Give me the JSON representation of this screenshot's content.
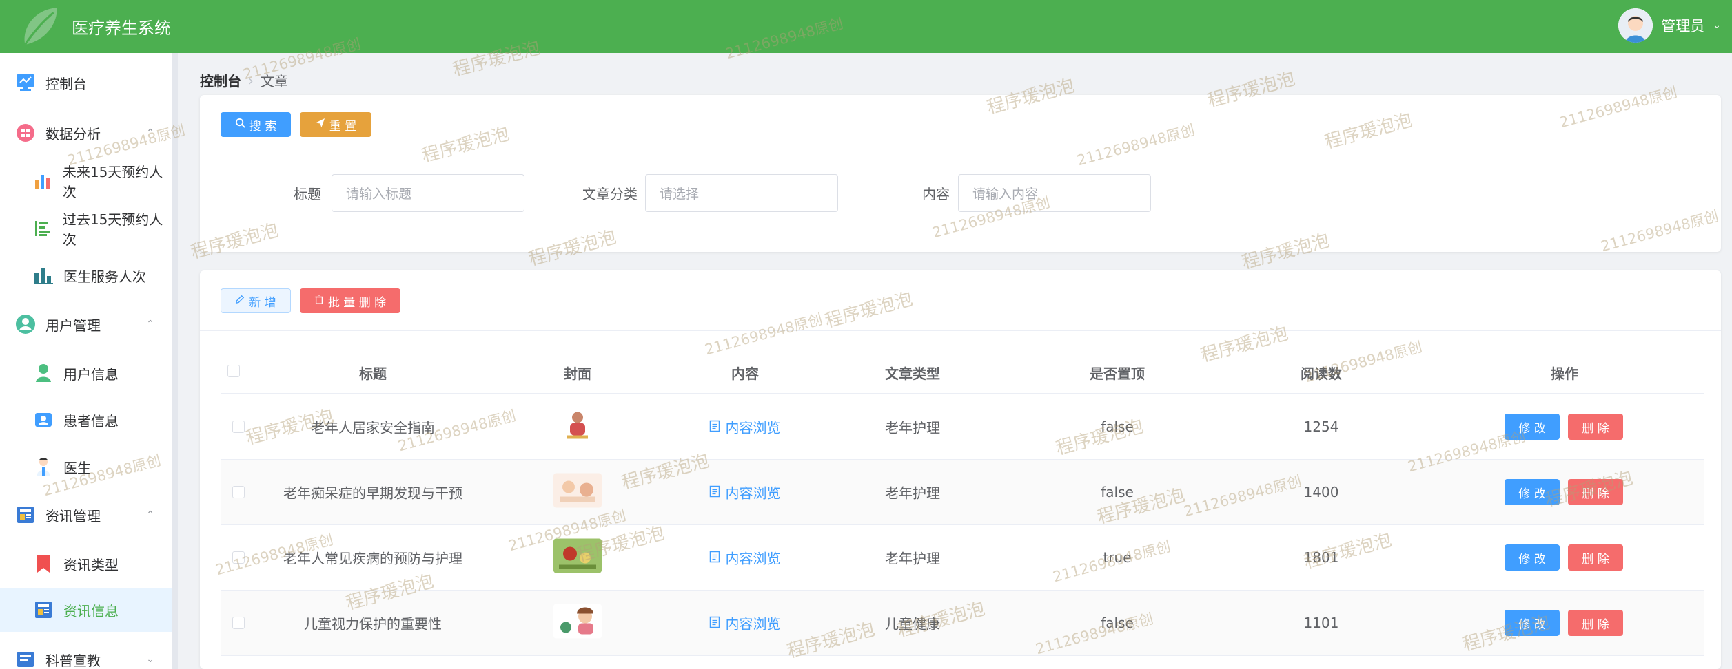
{
  "app": {
    "title": "医疗养生系统"
  },
  "user": {
    "name": "管理员"
  },
  "sidebar": {
    "items": [
      {
        "label": "控制台"
      },
      {
        "label": "数据分析"
      },
      {
        "label": "未来15天预约人次"
      },
      {
        "label": "过去15天预约人次"
      },
      {
        "label": "医生服务人次"
      },
      {
        "label": "用户管理"
      },
      {
        "label": "用户信息"
      },
      {
        "label": "患者信息"
      },
      {
        "label": "医生"
      },
      {
        "label": "资讯管理"
      },
      {
        "label": "资讯类型"
      },
      {
        "label": "资讯信息"
      },
      {
        "label": "科普宣教"
      }
    ]
  },
  "breadcrumb": {
    "root": "控制台",
    "current": "文章"
  },
  "search": {
    "search_label": "搜 索",
    "reset_label": "重 置",
    "fields": [
      {
        "label": "标题",
        "placeholder": "请输入标题"
      },
      {
        "label": "文章分类",
        "placeholder": "请选择"
      },
      {
        "label": "内容",
        "placeholder": "请输入内容"
      }
    ]
  },
  "actions": {
    "add_label": "新 增",
    "batch_delete_label": "批 量 删 除"
  },
  "table": {
    "columns": [
      "标题",
      "封面",
      "内容",
      "文章类型",
      "是否置顶",
      "阅读数",
      "操作"
    ],
    "view_label": "内容浏览",
    "edit_label": "修 改",
    "delete_label": "删 除",
    "rows": [
      {
        "title": "老年人居家安全指南",
        "type": "老年护理",
        "pinned": "false",
        "reads": "1254"
      },
      {
        "title": "老年痴呆症的早期发现与干预",
        "type": "老年护理",
        "pinned": "false",
        "reads": "1400"
      },
      {
        "title": "老年人常见疾病的预防与护理",
        "type": "老年护理",
        "pinned": "true",
        "reads": "1801"
      },
      {
        "title": "儿童视力保护的重要性",
        "type": "儿童健康",
        "pinned": "false",
        "reads": "1101"
      }
    ]
  },
  "watermark": {
    "text_a": "程序瑗泡泡",
    "text_b": "2112698948原创"
  },
  "colors": {
    "header": "#4caf50",
    "primary": "#409eff",
    "warning": "#e6a23c",
    "danger": "#f56c6c"
  }
}
